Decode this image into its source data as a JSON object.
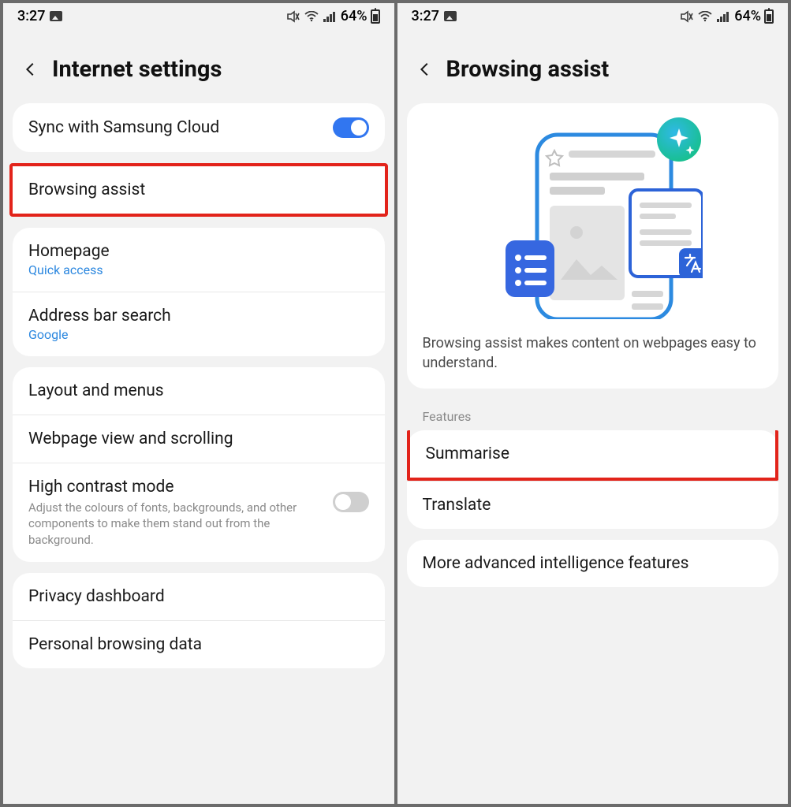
{
  "status": {
    "time": "3:27",
    "battery_pct": "64%"
  },
  "left": {
    "title": "Internet settings",
    "sync_label": "Sync with Samsung Cloud",
    "browsing_assist": "Browsing assist",
    "homepage": {
      "title": "Homepage",
      "sub": "Quick access"
    },
    "address_bar": {
      "title": "Address bar search",
      "sub": "Google"
    },
    "layout_menus": "Layout and menus",
    "webpage_view": "Webpage view and scrolling",
    "high_contrast": {
      "title": "High contrast mode",
      "desc": "Adjust the colours of fonts, backgrounds, and other components to make them stand out from the background."
    },
    "privacy_dashboard": "Privacy dashboard",
    "personal_browsing": "Personal browsing data"
  },
  "right": {
    "title": "Browsing assist",
    "description": "Browsing assist makes content on webpages easy to understand.",
    "features_label": "Features",
    "summarise": "Summarise",
    "translate": "Translate",
    "more_label": "More advanced intelligence features"
  }
}
